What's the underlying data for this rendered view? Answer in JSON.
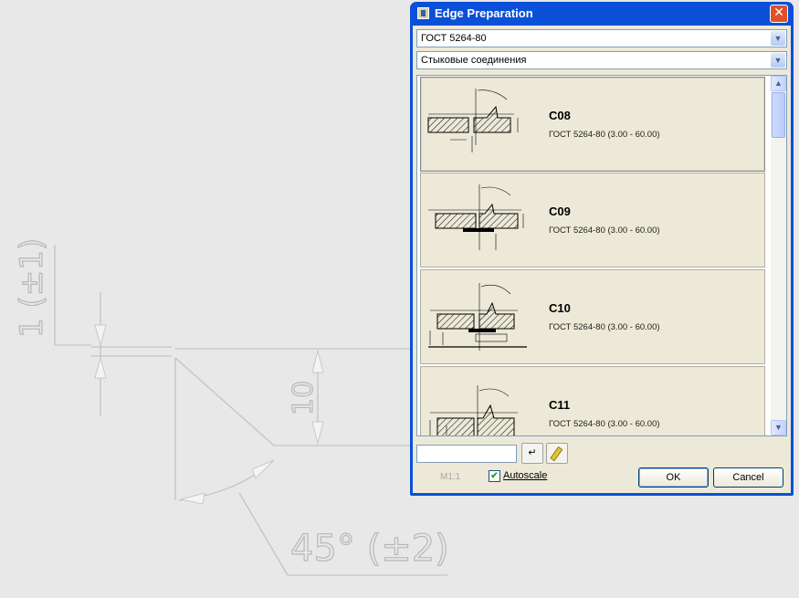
{
  "drawing": {
    "dim_vertical_text": "1 (±1)",
    "dim_depth_text": "10",
    "dim_angle_text": "45° (±2)"
  },
  "dialog": {
    "title": "Edge Preparation",
    "close_glyph": "✕",
    "standard_combo": {
      "value": "ГОСТ 5264-80"
    },
    "joint_type_combo": {
      "value": "Стыковые соединения"
    },
    "items": [
      {
        "code": "C08",
        "standard": "ГОСТ 5264-80 (3.00 - 60.00)"
      },
      {
        "code": "C09",
        "standard": "ГОСТ 5264-80 (3.00 - 60.00)"
      },
      {
        "code": "C10",
        "standard": "ГОСТ 5264-80 (3.00 - 60.00)"
      },
      {
        "code": "C11",
        "standard": "ГОСТ 5264-80 (3.00 - 60.00)"
      }
    ],
    "value_input": "",
    "enter_glyph": "↵",
    "scale_label": "M1:1",
    "autoscale": {
      "label": "Autoscale",
      "checked": true,
      "check_glyph": "✔"
    },
    "ok_label": "OK",
    "cancel_label": "Cancel"
  },
  "colors": {
    "title_bar": "#0a50d8",
    "dialog_face": "#ece9d8",
    "canvas_bg": "#e8e8e8"
  }
}
